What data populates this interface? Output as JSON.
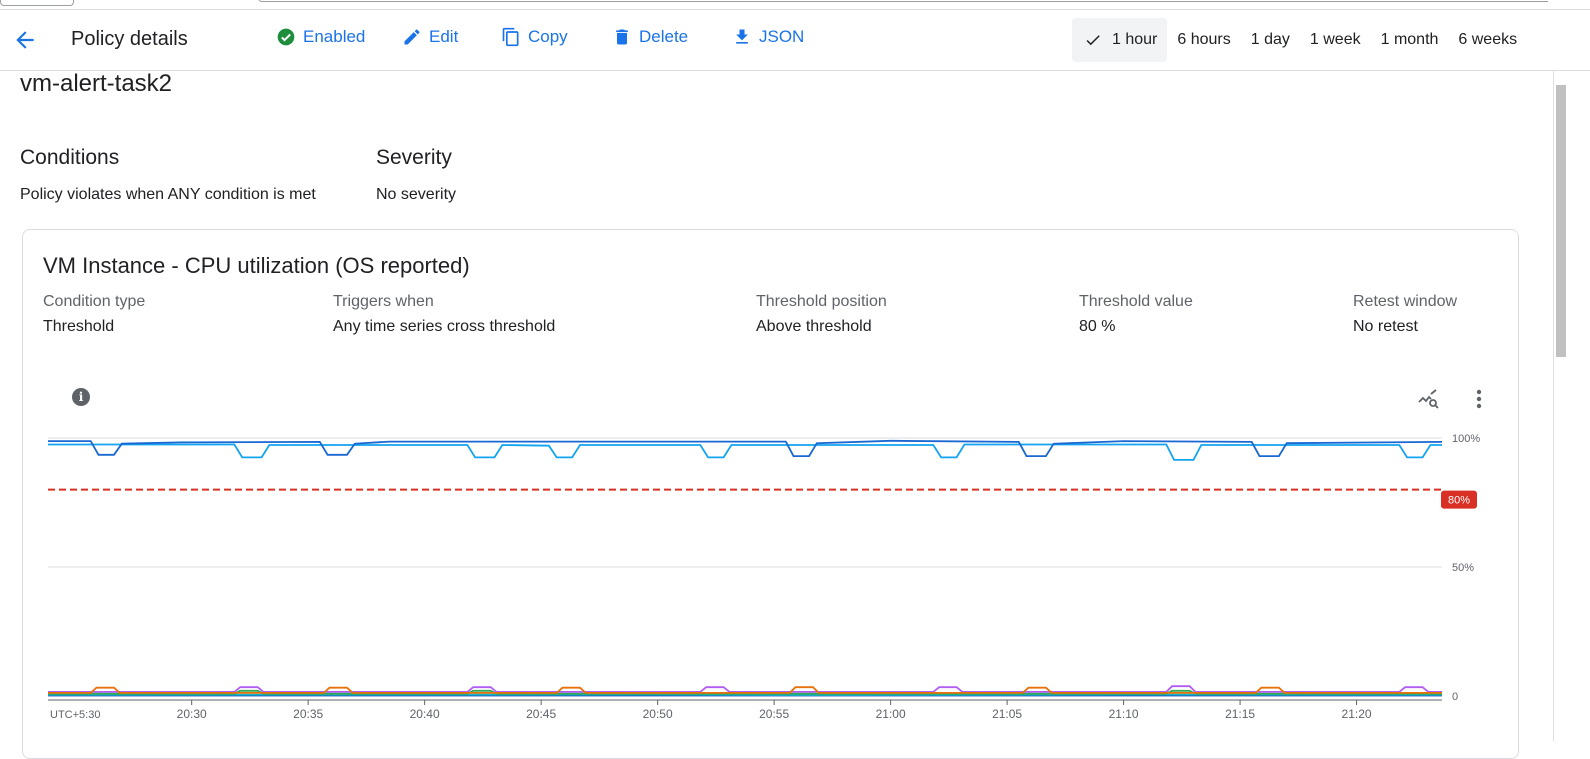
{
  "header": {
    "title": "Policy details",
    "actions": [
      {
        "label": "Enabled",
        "icon": "check-circle-icon"
      },
      {
        "label": "Edit",
        "icon": "pencil-icon"
      },
      {
        "label": "Copy",
        "icon": "copy-icon"
      },
      {
        "label": "Delete",
        "icon": "trash-icon"
      },
      {
        "label": "JSON",
        "icon": "download-icon"
      }
    ],
    "time_ranges": [
      "1 hour",
      "6 hours",
      "1 day",
      "1 week",
      "1 month",
      "6 weeks"
    ],
    "selected_range": "1 hour"
  },
  "policy_name": "vm-alert-task2",
  "conditions": {
    "heading": "Conditions",
    "value": "Policy violates when ANY condition is met"
  },
  "severity": {
    "heading": "Severity",
    "value": "No severity"
  },
  "condition_card": {
    "title": "VM Instance - CPU utilization (OS reported)",
    "fields": [
      {
        "label": "Condition type",
        "value": "Threshold"
      },
      {
        "label": "Triggers when",
        "value": "Any time series cross threshold"
      },
      {
        "label": "Threshold position",
        "value": "Above threshold"
      },
      {
        "label": "Threshold value",
        "value": "80 %"
      },
      {
        "label": "Retest window",
        "value": "No retest"
      }
    ]
  },
  "colors": {
    "accent": "#1a73e8",
    "enabled": "#1e8e3e",
    "threshold": "#d93025"
  },
  "chart_data": {
    "type": "line",
    "x_tick_labels": [
      "UTC+5:30",
      "20:30",
      "20:35",
      "20:40",
      "20:45",
      "20:50",
      "20:55",
      "21:00",
      "21:05",
      "21:10",
      "21:15",
      "21:20"
    ],
    "x_ticks": [
      "20:30",
      "20:35",
      "20:40",
      "20:45",
      "20:50",
      "20:55",
      "21:00",
      "21:05",
      "21:10",
      "21:15",
      "21:20"
    ],
    "xlim": [
      "20:23:50",
      "21:23:40"
    ],
    "y_tick_labels": [
      "100%",
      "50%",
      "0"
    ],
    "y_ticks": [
      100,
      50,
      0
    ],
    "ylim": [
      0,
      100
    ],
    "grid": true,
    "threshold": {
      "value": 80,
      "label": "80%",
      "color": "#d93025"
    },
    "series": [
      {
        "color": "#1967d2",
        "points": [
          [
            "20:23:50",
            98.8
          ],
          [
            "20:25:40",
            98.8
          ],
          [
            "20:26:00",
            93.5
          ],
          [
            "20:26:40",
            93.5
          ],
          [
            "20:27:00",
            97.8
          ],
          [
            "20:29:30",
            98.3
          ],
          [
            "20:35:30",
            98.5
          ],
          [
            "20:35:50",
            93.5
          ],
          [
            "20:36:40",
            93.5
          ],
          [
            "20:37:00",
            97.8
          ],
          [
            "20:38:30",
            98.6
          ],
          [
            "20:55:30",
            98.6
          ],
          [
            "20:55:50",
            93
          ],
          [
            "20:56:30",
            93
          ],
          [
            "20:56:50",
            98
          ],
          [
            "21:00:00",
            98.9
          ],
          [
            "21:05:30",
            98.5
          ],
          [
            "21:05:50",
            93
          ],
          [
            "21:06:40",
            93
          ],
          [
            "21:07:00",
            97.8
          ],
          [
            "21:10:00",
            98.8
          ],
          [
            "21:15:30",
            98.5
          ],
          [
            "21:15:50",
            93
          ],
          [
            "21:16:40",
            93
          ],
          [
            "21:17:00",
            98
          ],
          [
            "21:23:40",
            98.5
          ]
        ]
      },
      {
        "color": "#12a4f0",
        "points": [
          [
            "20:23:50",
            97.5
          ],
          [
            "20:31:50",
            97.5
          ],
          [
            "20:32:10",
            92.5
          ],
          [
            "20:33:00",
            92.5
          ],
          [
            "20:33:20",
            97.3
          ],
          [
            "20:41:50",
            97.3
          ],
          [
            "20:42:10",
            92.5
          ],
          [
            "20:43:00",
            92.5
          ],
          [
            "20:43:20",
            97.3
          ],
          [
            "20:45:20",
            97
          ],
          [
            "20:45:40",
            92.5
          ],
          [
            "20:46:20",
            92.5
          ],
          [
            "20:46:40",
            97.3
          ],
          [
            "20:51:50",
            97.3
          ],
          [
            "20:52:10",
            92.5
          ],
          [
            "20:52:50",
            92.5
          ],
          [
            "20:53:10",
            97.3
          ],
          [
            "21:01:50",
            97.3
          ],
          [
            "21:02:10",
            92.5
          ],
          [
            "21:02:50",
            92.5
          ],
          [
            "21:03:10",
            97.5
          ],
          [
            "21:11:50",
            97.5
          ],
          [
            "21:12:10",
            91.5
          ],
          [
            "21:13:00",
            91.5
          ],
          [
            "21:13:20",
            97.3
          ],
          [
            "21:21:50",
            97.3
          ],
          [
            "21:22:10",
            92.5
          ],
          [
            "21:22:50",
            92.5
          ],
          [
            "21:23:10",
            97.3
          ],
          [
            "21:23:40",
            97.3
          ]
        ]
      },
      {
        "color": "#e8710a",
        "points": [
          [
            "20:23:50",
            1.2
          ],
          [
            "20:25:40",
            1.2
          ],
          [
            "20:25:55",
            3.2
          ],
          [
            "20:26:40",
            3.2
          ],
          [
            "20:26:55",
            1.2
          ],
          [
            "20:35:40",
            1.2
          ],
          [
            "20:35:55",
            3.2
          ],
          [
            "20:36:40",
            3.2
          ],
          [
            "20:36:55",
            1.2
          ],
          [
            "20:45:40",
            1.2
          ],
          [
            "20:45:55",
            3.2
          ],
          [
            "20:46:40",
            3.2
          ],
          [
            "20:46:55",
            1.2
          ],
          [
            "20:55:40",
            1.2
          ],
          [
            "20:55:55",
            3.4
          ],
          [
            "20:56:40",
            3.4
          ],
          [
            "20:56:55",
            1.2
          ],
          [
            "21:05:40",
            1.2
          ],
          [
            "21:05:55",
            3.2
          ],
          [
            "21:06:40",
            3.2
          ],
          [
            "21:06:55",
            1.2
          ],
          [
            "21:15:40",
            1.2
          ],
          [
            "21:15:55",
            3.2
          ],
          [
            "21:16:40",
            3.2
          ],
          [
            "21:16:55",
            1.2
          ],
          [
            "21:23:40",
            1.2
          ]
        ]
      },
      {
        "color": "#b15cf2",
        "points": [
          [
            "20:23:50",
            1.6
          ],
          [
            "20:31:50",
            1.6
          ],
          [
            "20:32:05",
            3.4
          ],
          [
            "20:32:50",
            3.4
          ],
          [
            "20:33:05",
            1.6
          ],
          [
            "20:41:50",
            1.6
          ],
          [
            "20:42:05",
            3.4
          ],
          [
            "20:42:50",
            3.4
          ],
          [
            "20:43:05",
            1.6
          ],
          [
            "20:51:50",
            1.6
          ],
          [
            "20:52:05",
            3.4
          ],
          [
            "20:52:50",
            3.4
          ],
          [
            "20:53:05",
            1.6
          ],
          [
            "21:01:50",
            1.6
          ],
          [
            "21:02:05",
            3.4
          ],
          [
            "21:02:50",
            3.4
          ],
          [
            "21:03:05",
            1.6
          ],
          [
            "21:11:50",
            1.6
          ],
          [
            "21:12:05",
            3.8
          ],
          [
            "21:12:50",
            3.8
          ],
          [
            "21:13:05",
            1.6
          ],
          [
            "21:21:50",
            1.6
          ],
          [
            "21:22:05",
            3.4
          ],
          [
            "21:22:50",
            3.4
          ],
          [
            "21:23:05",
            1.6
          ],
          [
            "21:23:40",
            1.6
          ]
        ]
      },
      {
        "color": "#34a853",
        "points": [
          [
            "20:23:50",
            0.9
          ],
          [
            "20:31:50",
            0.9
          ],
          [
            "20:32:05",
            2
          ],
          [
            "20:32:50",
            2
          ],
          [
            "20:33:05",
            0.9
          ],
          [
            "20:41:50",
            0.9
          ],
          [
            "20:42:05",
            2
          ],
          [
            "20:42:50",
            2
          ],
          [
            "20:43:05",
            0.9
          ],
          [
            "21:11:50",
            0.9
          ],
          [
            "21:12:05",
            2
          ],
          [
            "21:12:50",
            2
          ],
          [
            "21:13:05",
            0.9
          ],
          [
            "21:23:40",
            0.9
          ]
        ]
      },
      {
        "color": "#12b5cb",
        "points": [
          [
            "20:23:50",
            0.5
          ],
          [
            "20:50:00",
            0.6
          ],
          [
            "20:56:00",
            0.4
          ],
          [
            "21:10:00",
            0.6
          ],
          [
            "21:23:40",
            0.5
          ]
        ]
      },
      {
        "color": "#185abc",
        "points": [
          [
            "20:23:50",
            0.2
          ],
          [
            "21:23:40",
            0.2
          ]
        ]
      }
    ]
  }
}
